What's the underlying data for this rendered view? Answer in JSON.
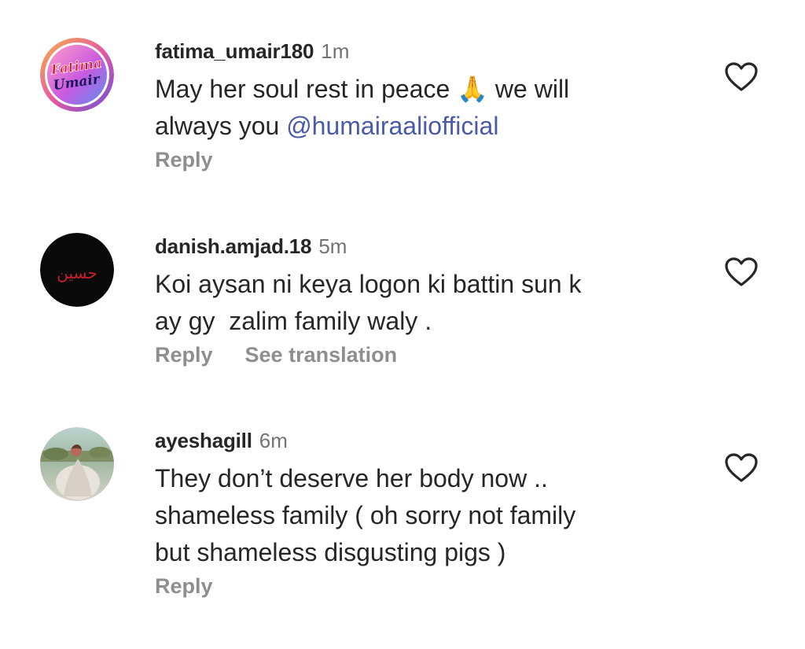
{
  "comments": [
    {
      "username": "fatima_umair180",
      "time": "1m",
      "text_before": "May her soul rest in peace 🙏 we will\nalways you ",
      "mention": "@humairaaliofficial",
      "reply_label": "Reply",
      "avatar_text_1": "Fatima",
      "avatar_text_2": "Umair",
      "like_icon": "heart-outline-icon"
    },
    {
      "username": "danish.amjad.18",
      "time": "5m",
      "text": "Koi aysan ni keya logon ki battin sun k\nay gy  zalim family waly .",
      "reply_label": "Reply",
      "translation_label": "See translation",
      "avatar_text": "حسین",
      "like_icon": "heart-outline-icon"
    },
    {
      "username": "ayeshagill",
      "time": "6m",
      "text": "They don’t deserve her body now ..\nshameless family ( oh sorry not family\nbut shameless disgusting pigs )",
      "reply_label": "Reply",
      "like_icon": "heart-outline-icon"
    }
  ],
  "colors": {
    "username": "#262626",
    "secondary": "#737373",
    "action": "#8e8e8e",
    "mention": "#4a5aa8"
  }
}
